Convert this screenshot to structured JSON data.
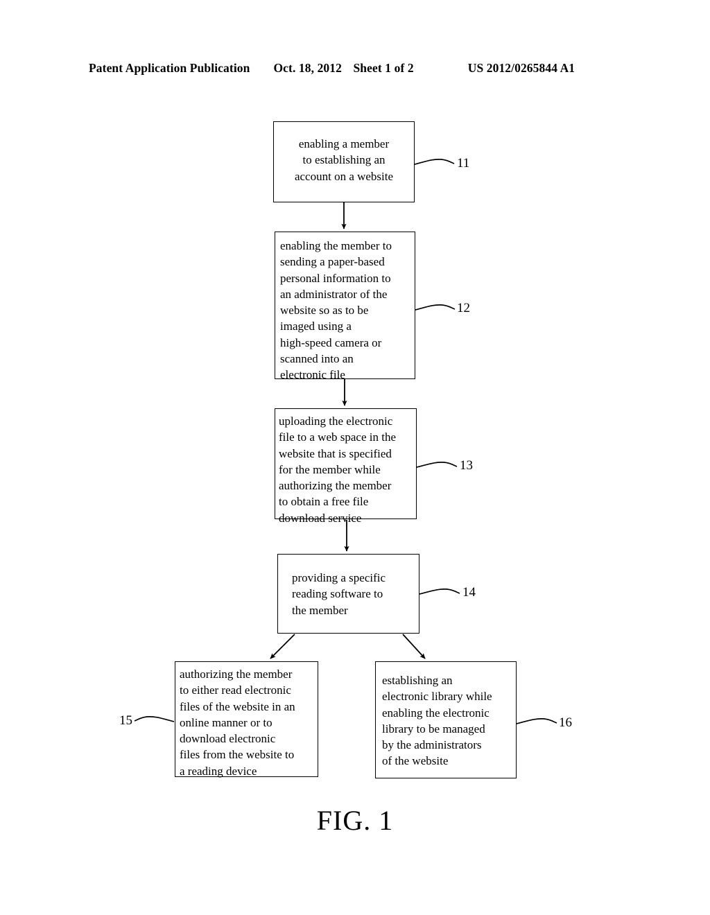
{
  "header": {
    "publication": "Patent Application Publication",
    "date": "Oct. 18, 2012",
    "sheet": "Sheet 1 of 2",
    "doc_number": "US 2012/0265844 A1"
  },
  "figure": {
    "caption": "FIG. 1",
    "type": "flowchart"
  },
  "flowchart": {
    "steps": [
      {
        "ref": "11",
        "align": "center",
        "text": "enabling a member\nto establishing an\naccount on a website"
      },
      {
        "ref": "12",
        "align": "left",
        "text": "enabling the member to\nsending a paper-based\npersonal information to\nan administrator of the\nwebsite so as to be\nimaged using a\nhigh-speed camera or\nscanned into an\nelectronic file"
      },
      {
        "ref": "13",
        "align": "left",
        "text": "uploading the electronic\nfile to a web space in the\nwebsite that is specified\nfor the member while\nauthorizing the member\nto obtain a free file\ndownload service"
      },
      {
        "ref": "14",
        "align": "left",
        "text": "providing a specific\nreading software to\nthe member"
      },
      {
        "ref": "15",
        "align": "left",
        "text": "authorizing the member\nto either read electronic\nfiles of the website in an\nonline manner or to\ndownload electronic\nfiles from the website to\na reading device"
      },
      {
        "ref": "16",
        "align": "left",
        "text": "establishing an\nelectronic library while\nenabling the electronic\nlibrary to be managed\nby the administrators\nof the website"
      }
    ]
  },
  "colors": {
    "ink": "#000000",
    "paper": "#ffffff"
  }
}
